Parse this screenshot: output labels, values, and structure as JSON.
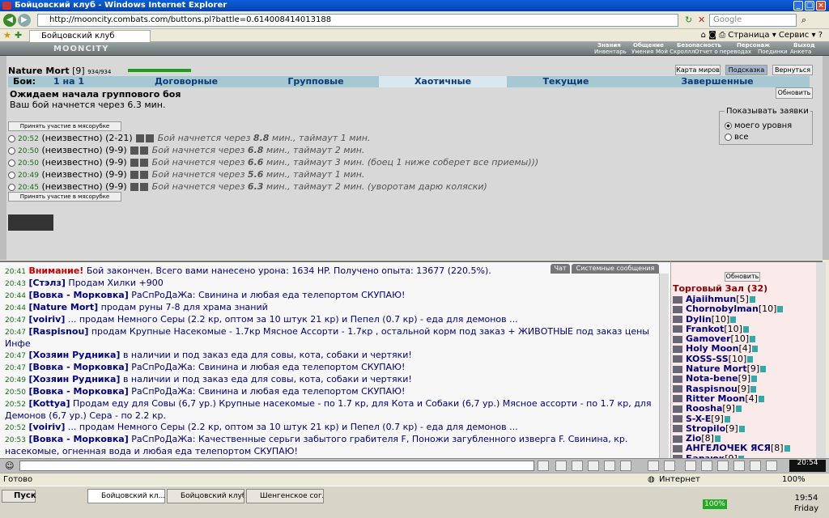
{
  "browser": {
    "title": "Бойцовский клуб - Windows Internet Explorer",
    "url": "http://mooncity.combats.com/buttons.pl?battle=0.614008414013188",
    "search_placeholder": "Google",
    "tab": "Бойцовский клуб",
    "page_menu": "Страница",
    "tools_menu": "Сервис",
    "status": "Готово",
    "zone": "Интернет",
    "zoom": "100%"
  },
  "game": {
    "logo": "MOONCITY",
    "menu1": [
      "Знания",
      "Общение",
      "Безопасность",
      "Персонаж",
      "Выход"
    ],
    "menu2": [
      "Инвентарь",
      "Умения",
      "Мой Скроллл",
      "Отчет о переводах",
      "Поединки",
      "Анкета"
    ]
  },
  "player": {
    "name": "Nature Mort",
    "level": "[9]",
    "hp": "934/934"
  },
  "topbuttons": [
    "Карта миров",
    "Подсказка",
    "Вернуться"
  ],
  "tabs": {
    "label": "Бои:",
    "items": [
      "1 на 1",
      "Договорные",
      "Групповые",
      "Хаотичные",
      "Текущие",
      "Завершенные"
    ]
  },
  "waiting": {
    "title": "Ожидаем начала группового боя",
    "sub": "Ваш бой начнется через 6.3 мин.",
    "refresh": "Обновить"
  },
  "show": {
    "legend": "Показывать заявки",
    "opt1": "моего уровня",
    "opt2": "все"
  },
  "join_label": "Принять участие в мясорубке",
  "battles": [
    {
      "time": "20:52",
      "who": "(неизвестно)",
      "lvl": "(2-21)",
      "info": "Бой начнется через",
      "min": "8.8",
      "rest": "мин., таймаут 1 мин."
    },
    {
      "time": "20:50",
      "who": "(неизвестно)",
      "lvl": "(9-9)",
      "info": "Бой начнется через",
      "min": "6.8",
      "rest": "мин., таймаут 2 мин."
    },
    {
      "time": "20:50",
      "who": "(неизвестно)",
      "lvl": "(9-9)",
      "info": "Бой начнется через",
      "min": "6.6",
      "rest": "мин., таймаут 3 мин. (боец 1 ниже соберет все приемы)))"
    },
    {
      "time": "20:49",
      "who": "(неизвестно)",
      "lvl": "(9-9)",
      "info": "Бой начнется через",
      "min": "5.6",
      "rest": "мин., таймаут 1 мин."
    },
    {
      "time": "20:45",
      "who": "(неизвестно)",
      "lvl": "(9-9)",
      "info": "Бой начнется через",
      "min": "6.3",
      "rest": "мин., таймаут 2 мин. (уворотам дарю коляски)"
    }
  ],
  "chat_tabs": [
    "Чат",
    "Системные сообщения"
  ],
  "chat": [
    {
      "time": "20:41",
      "nick": "Внимание!",
      "text": "Бой закончен. Всего вами нанесено урона: 1634 HP. Получено опыта: 13677 (220.5%)."
    },
    {
      "time": "20:43",
      "nick": "[Стэлз]",
      "text": "Продам Хилки +900"
    },
    {
      "time": "20:44",
      "nick": "[Вовка - Морковка]",
      "text": "РаСпРоДаЖа: Свинина и любая еда телепортом СКУПАЮ!"
    },
    {
      "time": "20:44",
      "nick": "[Nature Mort]",
      "text": "продам руны 7-8 для храма знаний"
    },
    {
      "time": "20:47",
      "nick": "[voiriv]",
      "text": "... продам Немного Серы (2.2 кр, оптом за 10 штук 21 кр) и Пепел (0.7 кр) - еда для демонов ..."
    },
    {
      "time": "20:47",
      "nick": "[Raspisnou]",
      "text": "продам Крупные Насекомые - 1.7кр Мясное Ассорти - 1.7кр , остальной корм под заказ + ЖИВОТНЫЕ под заказ цены в"
    },
    {
      "time": "",
      "nick": "",
      "text": "Инфе"
    },
    {
      "time": "20:47",
      "nick": "[Хозяин Рудника]",
      "text": "в наличии и под заказ еда для совы, кота, собаки и чертяки!"
    },
    {
      "time": "20:47",
      "nick": "[Вовка - Морковка]",
      "text": "РаСпРоДаЖа: Свинина и любая еда телепортом СКУПАЮ!"
    },
    {
      "time": "20:49",
      "nick": "[Хозяин Рудника]",
      "text": "в наличии и под заказ еда для совы, кота, собаки и чертяки!"
    },
    {
      "time": "20:50",
      "nick": "[Вовка - Морковка]",
      "text": "РаСпРоДаЖа: Свинина и любая еда телепортом СКУПАЮ!"
    },
    {
      "time": "20:52",
      "nick": "[Kottya]",
      "text": "Продам еду для Совы (6,7 ур.) Крупные насекомые - по 1.7 кр, для Кота и Собаки (6,7 ур.) Мясное ассорти - по 1.7 кр, для"
    },
    {
      "time": "",
      "nick": "",
      "text": "Демонов (6,7 ур.) Сера - по 2.2 кр."
    },
    {
      "time": "20:52",
      "nick": "[voiriv]",
      "text": "... продам Немного Серы (2.2 кр, оптом за 10 штук 21 кр) и Пепел (0.7 кр) - еда для демонов ..."
    },
    {
      "time": "20:53",
      "nick": "[Вовка - Морковка]",
      "text": "РаСпРоДаЖа: Качественные серьги забытого грабителя F, Поножи загубленного изверга F. Свинина, кр."
    },
    {
      "time": "",
      "nick": "",
      "text": "насекомые, огненная вода и любая еда телепортом СКУПАЮ!"
    }
  ],
  "room": {
    "refresh": "Обновить",
    "title": "Торговый Зал (32)",
    "users": [
      {
        "name": "Ajaiihmun",
        "lvl": "[5]"
      },
      {
        "name": "Chornobylman",
        "lvl": "[10]"
      },
      {
        "name": "Dylin",
        "lvl": "[10]"
      },
      {
        "name": "Frankot",
        "lvl": "[10]"
      },
      {
        "name": "Gamover",
        "lvl": "[10]"
      },
      {
        "name": "Holy Moon",
        "lvl": "[4]"
      },
      {
        "name": "KOSS-SS",
        "lvl": "[10]"
      },
      {
        "name": "Nature Mort",
        "lvl": "[9]"
      },
      {
        "name": "Nota-bene",
        "lvl": "[9]"
      },
      {
        "name": "Raspisnou",
        "lvl": "[9]"
      },
      {
        "name": "Ritter Moon",
        "lvl": "[4]"
      },
      {
        "name": "Roosha",
        "lvl": "[9]"
      },
      {
        "name": "S-X-E",
        "lvl": "[9]"
      },
      {
        "name": "Stropilo",
        "lvl": "[9]"
      },
      {
        "name": "Zio",
        "lvl": "[8]"
      },
      {
        "name": "АНГЕЛОЧЕК ЯСЯ",
        "lvl": "[8]"
      },
      {
        "name": "Барзюк",
        "lvl": "[9]"
      }
    ]
  },
  "gametime": "20:54",
  "taskbar": {
    "start": "Пуск",
    "tasks": [
      "Бойцовский кл...",
      "Бойцовский клуб...",
      "Шенгенское согл..."
    ],
    "battery": "100%",
    "time": "19:54",
    "day": "Friday"
  }
}
